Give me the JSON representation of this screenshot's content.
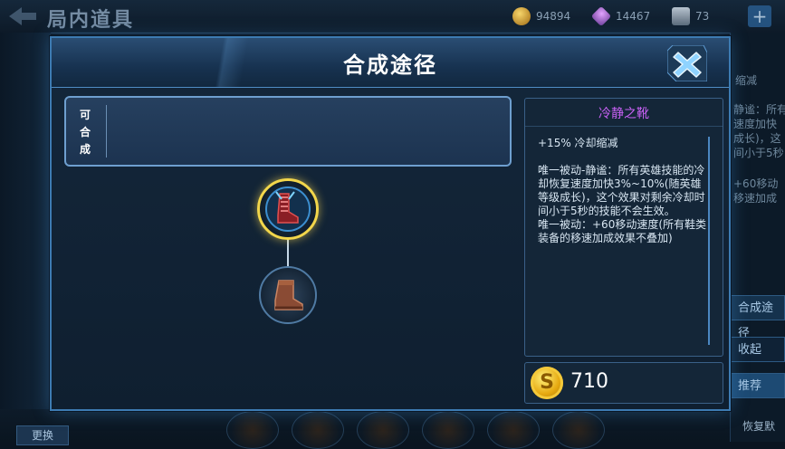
{
  "background": {
    "title": "局内道具",
    "gold": "94894",
    "gems": "14467",
    "tickets": "73",
    "plus_label": "+",
    "right_texts": [
      "缩减",
      "静谧：所有",
      "速度加快",
      "成长)，这",
      "间小于5秒",
      "+60移动",
      "移速加成"
    ],
    "right_compose_btn": "合成途径",
    "right_collapse": "收起",
    "right_recommend": "推荐",
    "right_restore": "恢复默",
    "bottom_btn": "更换"
  },
  "dialog": {
    "title": "合成途径",
    "compose_label": "可合成",
    "item_name": "冷静之靴",
    "item_desc": "+15% 冷却缩减\n\n唯一被动-静谧：所有英雄技能的冷却恢复速度加快3%~10%(随英雄等级成长)，这个效果对剩余冷却时间小于5秒的技能不会生效。\n唯一被动：+60移动速度(所有鞋类装备的移速加成效果不叠加)",
    "price": "710",
    "coin_symbol": "S",
    "icons": {
      "close": "close-icon",
      "main_item": "boots-of-tranquility-icon",
      "child_item": "basic-boots-icon",
      "coin": "gold-coin-icon"
    }
  }
}
